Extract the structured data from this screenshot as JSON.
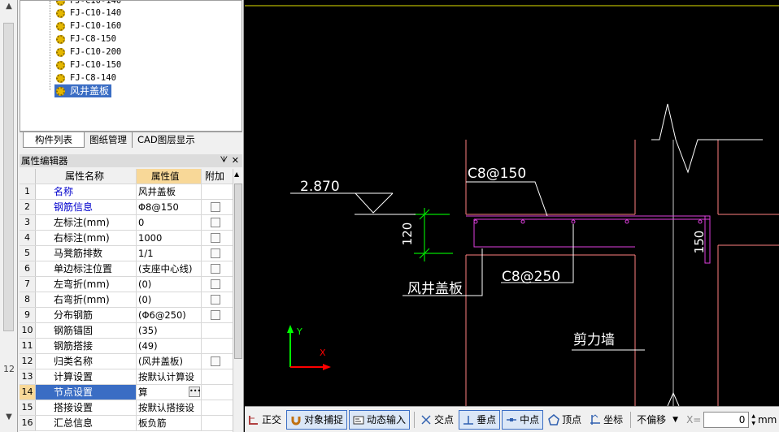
{
  "tree": {
    "items": [
      {
        "label": "FJ-C10-140"
      },
      {
        "label": "FJ-C10-160"
      },
      {
        "label": "FJ-C8-150"
      },
      {
        "label": "FJ-C10-200"
      },
      {
        "label": "FJ-C10-150"
      },
      {
        "label": "FJ-C8-140"
      },
      {
        "label": "风井盖板"
      }
    ],
    "partial_top": "FJ-C10-140"
  },
  "tabs": [
    {
      "label": "构件列表"
    },
    {
      "label": "图纸管理"
    },
    {
      "label": "CAD图层显示"
    }
  ],
  "property_editor": {
    "title": "属性编辑器",
    "headers": {
      "name": "属性名称",
      "value": "属性值",
      "extra": "附加"
    },
    "rows": [
      {
        "num": "1",
        "name": "名称",
        "value": "风井盖板",
        "blue": true,
        "check": false
      },
      {
        "num": "2",
        "name": "钢筋信息",
        "value": "Φ8@150",
        "blue": true,
        "check": true
      },
      {
        "num": "3",
        "name": "左标注(mm)",
        "value": "0",
        "blue": false,
        "check": true
      },
      {
        "num": "4",
        "name": "右标注(mm)",
        "value": "1000",
        "blue": false,
        "check": true
      },
      {
        "num": "5",
        "name": "马凳筋排数",
        "value": "1/1",
        "blue": false,
        "check": true
      },
      {
        "num": "6",
        "name": "单边标注位置",
        "value": "(支座中心线)",
        "blue": false,
        "check": true
      },
      {
        "num": "7",
        "name": "左弯折(mm)",
        "value": "(0)",
        "blue": false,
        "check": true
      },
      {
        "num": "8",
        "name": "右弯折(mm)",
        "value": "(0)",
        "blue": false,
        "check": true
      },
      {
        "num": "9",
        "name": "分布钢筋",
        "value": "(Φ6@250)",
        "blue": false,
        "check": true
      },
      {
        "num": "10",
        "name": "钢筋锚固",
        "value": "(35)",
        "blue": false,
        "check": false
      },
      {
        "num": "11",
        "name": "钢筋搭接",
        "value": "(49)",
        "blue": false,
        "check": false
      },
      {
        "num": "12",
        "name": "归类名称",
        "value": "(风井盖板)",
        "blue": false,
        "check": true
      },
      {
        "num": "13",
        "name": "计算设置",
        "value": "按默认计算设",
        "blue": false,
        "check": false
      },
      {
        "num": "14",
        "name": "节点设置",
        "value": "算",
        "blue": false,
        "check": false,
        "selected": true
      },
      {
        "num": "15",
        "name": "搭接设置",
        "value": "按默认搭接设",
        "blue": false,
        "check": false
      },
      {
        "num": "16",
        "name": "汇总信息",
        "value": "板负筋",
        "blue": false,
        "check": false
      }
    ]
  },
  "cad": {
    "elevation": "2.870",
    "dim_120": "120",
    "dim_150": "150",
    "top_rebar": "C8@150",
    "bottom_rebar": "C8@250",
    "slab_label": "风井盖板",
    "wall_label": "剪力墙",
    "axis_y": "Y",
    "axis_x": "X",
    "colors": {
      "slab": "#e040e0",
      "wall": "#ff8080",
      "dim": "#00e000",
      "text": "#ffffff",
      "axis_y": "#00ff00",
      "axis_x": "#ff0000"
    }
  },
  "statusbar": {
    "ortho": "正交",
    "osnap": "对象捕捉",
    "dynamic": "动态输入",
    "intersection": "交点",
    "perpendicular": "垂点",
    "midpoint": "中点",
    "vertex": "顶点",
    "coordinate": "坐标",
    "offset": "不偏移",
    "x_label": "X=",
    "x_value": "0",
    "unit": "mm"
  },
  "left_strip": {
    "label_12": "12"
  }
}
